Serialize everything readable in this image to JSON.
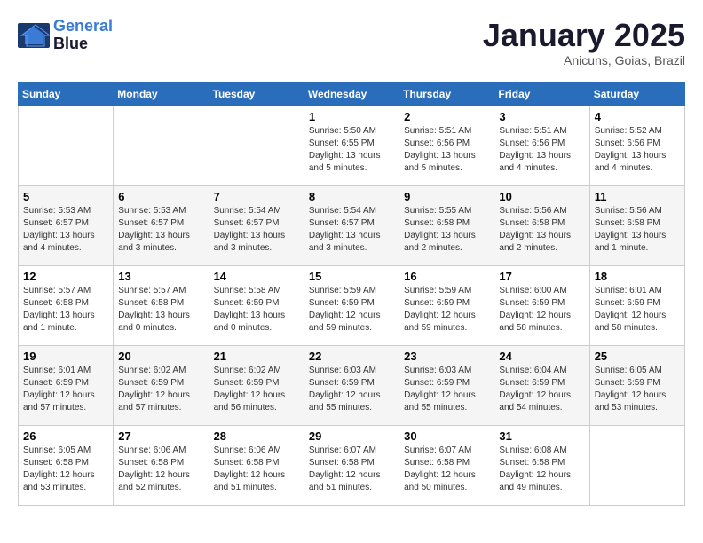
{
  "header": {
    "logo_line1": "General",
    "logo_line2": "Blue",
    "month_title": "January 2025",
    "subtitle": "Anicuns, Goias, Brazil"
  },
  "weekdays": [
    "Sunday",
    "Monday",
    "Tuesday",
    "Wednesday",
    "Thursday",
    "Friday",
    "Saturday"
  ],
  "weeks": [
    [
      {
        "day": "",
        "info": ""
      },
      {
        "day": "",
        "info": ""
      },
      {
        "day": "",
        "info": ""
      },
      {
        "day": "1",
        "info": "Sunrise: 5:50 AM\nSunset: 6:55 PM\nDaylight: 13 hours\nand 5 minutes."
      },
      {
        "day": "2",
        "info": "Sunrise: 5:51 AM\nSunset: 6:56 PM\nDaylight: 13 hours\nand 5 minutes."
      },
      {
        "day": "3",
        "info": "Sunrise: 5:51 AM\nSunset: 6:56 PM\nDaylight: 13 hours\nand 4 minutes."
      },
      {
        "day": "4",
        "info": "Sunrise: 5:52 AM\nSunset: 6:56 PM\nDaylight: 13 hours\nand 4 minutes."
      }
    ],
    [
      {
        "day": "5",
        "info": "Sunrise: 5:53 AM\nSunset: 6:57 PM\nDaylight: 13 hours\nand 4 minutes."
      },
      {
        "day": "6",
        "info": "Sunrise: 5:53 AM\nSunset: 6:57 PM\nDaylight: 13 hours\nand 3 minutes."
      },
      {
        "day": "7",
        "info": "Sunrise: 5:54 AM\nSunset: 6:57 PM\nDaylight: 13 hours\nand 3 minutes."
      },
      {
        "day": "8",
        "info": "Sunrise: 5:54 AM\nSunset: 6:57 PM\nDaylight: 13 hours\nand 3 minutes."
      },
      {
        "day": "9",
        "info": "Sunrise: 5:55 AM\nSunset: 6:58 PM\nDaylight: 13 hours\nand 2 minutes."
      },
      {
        "day": "10",
        "info": "Sunrise: 5:56 AM\nSunset: 6:58 PM\nDaylight: 13 hours\nand 2 minutes."
      },
      {
        "day": "11",
        "info": "Sunrise: 5:56 AM\nSunset: 6:58 PM\nDaylight: 13 hours\nand 1 minute."
      }
    ],
    [
      {
        "day": "12",
        "info": "Sunrise: 5:57 AM\nSunset: 6:58 PM\nDaylight: 13 hours\nand 1 minute."
      },
      {
        "day": "13",
        "info": "Sunrise: 5:57 AM\nSunset: 6:58 PM\nDaylight: 13 hours\nand 0 minutes."
      },
      {
        "day": "14",
        "info": "Sunrise: 5:58 AM\nSunset: 6:59 PM\nDaylight: 13 hours\nand 0 minutes."
      },
      {
        "day": "15",
        "info": "Sunrise: 5:59 AM\nSunset: 6:59 PM\nDaylight: 12 hours\nand 59 minutes."
      },
      {
        "day": "16",
        "info": "Sunrise: 5:59 AM\nSunset: 6:59 PM\nDaylight: 12 hours\nand 59 minutes."
      },
      {
        "day": "17",
        "info": "Sunrise: 6:00 AM\nSunset: 6:59 PM\nDaylight: 12 hours\nand 58 minutes."
      },
      {
        "day": "18",
        "info": "Sunrise: 6:01 AM\nSunset: 6:59 PM\nDaylight: 12 hours\nand 58 minutes."
      }
    ],
    [
      {
        "day": "19",
        "info": "Sunrise: 6:01 AM\nSunset: 6:59 PM\nDaylight: 12 hours\nand 57 minutes."
      },
      {
        "day": "20",
        "info": "Sunrise: 6:02 AM\nSunset: 6:59 PM\nDaylight: 12 hours\nand 57 minutes."
      },
      {
        "day": "21",
        "info": "Sunrise: 6:02 AM\nSunset: 6:59 PM\nDaylight: 12 hours\nand 56 minutes."
      },
      {
        "day": "22",
        "info": "Sunrise: 6:03 AM\nSunset: 6:59 PM\nDaylight: 12 hours\nand 55 minutes."
      },
      {
        "day": "23",
        "info": "Sunrise: 6:03 AM\nSunset: 6:59 PM\nDaylight: 12 hours\nand 55 minutes."
      },
      {
        "day": "24",
        "info": "Sunrise: 6:04 AM\nSunset: 6:59 PM\nDaylight: 12 hours\nand 54 minutes."
      },
      {
        "day": "25",
        "info": "Sunrise: 6:05 AM\nSunset: 6:59 PM\nDaylight: 12 hours\nand 53 minutes."
      }
    ],
    [
      {
        "day": "26",
        "info": "Sunrise: 6:05 AM\nSunset: 6:58 PM\nDaylight: 12 hours\nand 53 minutes."
      },
      {
        "day": "27",
        "info": "Sunrise: 6:06 AM\nSunset: 6:58 PM\nDaylight: 12 hours\nand 52 minutes."
      },
      {
        "day": "28",
        "info": "Sunrise: 6:06 AM\nSunset: 6:58 PM\nDaylight: 12 hours\nand 51 minutes."
      },
      {
        "day": "29",
        "info": "Sunrise: 6:07 AM\nSunset: 6:58 PM\nDaylight: 12 hours\nand 51 minutes."
      },
      {
        "day": "30",
        "info": "Sunrise: 6:07 AM\nSunset: 6:58 PM\nDaylight: 12 hours\nand 50 minutes."
      },
      {
        "day": "31",
        "info": "Sunrise: 6:08 AM\nSunset: 6:58 PM\nDaylight: 12 hours\nand 49 minutes."
      },
      {
        "day": "",
        "info": ""
      }
    ]
  ]
}
